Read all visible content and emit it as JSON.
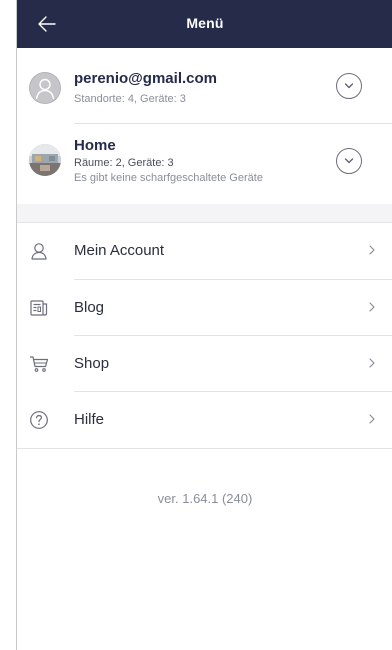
{
  "header": {
    "title": "Menü"
  },
  "accounts": [
    {
      "name": "perenio@gmail.com",
      "subtitle": "Standorte: 4, Geräte: 3"
    },
    {
      "name": "Home",
      "subtitle": "Räume: 2, Geräte: 3",
      "status": "Es gibt keine scharfgeschaltete Geräte"
    }
  ],
  "menu": [
    {
      "label": "Mein Account",
      "icon": "person-icon"
    },
    {
      "label": "Blog",
      "icon": "newspaper-icon"
    },
    {
      "label": "Shop",
      "icon": "cart-icon"
    },
    {
      "label": "Hilfe",
      "icon": "question-icon"
    }
  ],
  "footer": {
    "version": "ver. 1.64.1 (240)"
  },
  "colors": {
    "header_bg": "#262b4a",
    "header_text": "#ffffff",
    "secondary_text": "#8a8e9a"
  }
}
